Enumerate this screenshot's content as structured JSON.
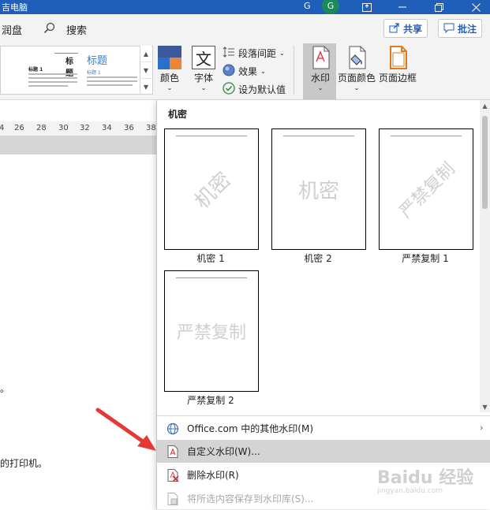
{
  "window": {
    "title_fragment": "吉电脑",
    "user_initial": "G",
    "user_letter": "G"
  },
  "menu": {
    "left_item": "润盘",
    "search_label": "搜索",
    "share_label": "共享",
    "comment_label": "批注"
  },
  "ribbon": {
    "gallery": {
      "title_small": "标题",
      "heading_large": "标题",
      "heading1_left": "标题 1",
      "heading1_right": "标题 1"
    },
    "colors_label": "颜色",
    "fonts_label": "字体",
    "paragraph_spacing_label": "段落间距",
    "effects_label": "效果",
    "set_default_label": "设为默认值",
    "watermark_label": "水印",
    "page_color_label": "页面颜色",
    "page_border_label": "页面边框"
  },
  "ruler": {
    "ticks": [
      "4",
      "26",
      "28",
      "30",
      "32",
      "34",
      "36",
      "38"
    ]
  },
  "document": {
    "text_fragment_1": "。",
    "text_fragment_2": "的打印机。"
  },
  "watermark_panel": {
    "section_title": "机密",
    "tiles": [
      {
        "label": "机密 1",
        "watermark_text": "机密"
      },
      {
        "label": "机密 2",
        "watermark_text": "机密"
      },
      {
        "label": "严禁复制 1",
        "watermark_text": "严禁复制"
      },
      {
        "label": "严禁复制 2",
        "watermark_text": "严禁复制"
      }
    ],
    "menu_items": [
      {
        "label": "Office.com 中的其他水印(M)",
        "icon": "globe-icon",
        "has_submenu": true
      },
      {
        "label": "自定义水印(W)...",
        "icon": "watermark-doc-icon",
        "highlighted": true
      },
      {
        "label": "删除水印(R)",
        "icon": "remove-watermark-icon"
      },
      {
        "label": "将所选内容保存到水印库(S)...",
        "icon": "save-to-gallery-icon",
        "disabled": true
      }
    ]
  },
  "overlay": {
    "site_watermark": "Baidu 经验",
    "site_url": "jingyan.baidu.com",
    "arrow_color": "#e53935"
  }
}
